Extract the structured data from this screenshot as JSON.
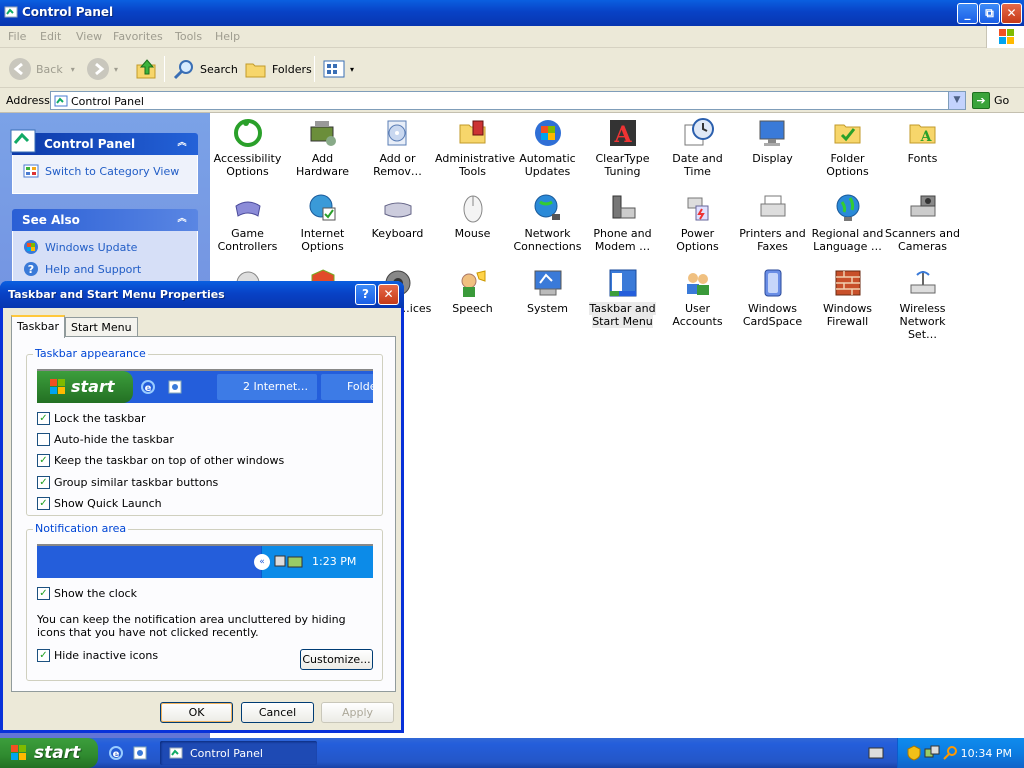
{
  "window": {
    "title": "Control Panel",
    "min_symbol": "_",
    "max_symbol": "⧉",
    "close_symbol": "✕"
  },
  "menu": [
    "File",
    "Edit",
    "View",
    "Favorites",
    "Tools",
    "Help"
  ],
  "toolbar": {
    "back": "Back",
    "search": "Search",
    "folders": "Folders"
  },
  "address": {
    "label": "Address",
    "value": "Control Panel",
    "go": "Go"
  },
  "taskpane": {
    "control_panel": {
      "title": "Control Panel",
      "link": "Switch to Category View"
    },
    "see_also": {
      "title": "See Also",
      "links": [
        "Windows Update",
        "Help and Support"
      ]
    }
  },
  "items": [
    {
      "label": "Accessibility Options",
      "icon": "accessibility-icon"
    },
    {
      "label": "Add Hardware",
      "icon": "add-hardware-icon"
    },
    {
      "label": "Add or Remov…",
      "icon": "add-remove-programs-icon"
    },
    {
      "label": "Administrative Tools",
      "icon": "administrative-tools-icon"
    },
    {
      "label": "Automatic Updates",
      "icon": "automatic-updates-icon"
    },
    {
      "label": "ClearType Tuning",
      "icon": "cleartype-icon"
    },
    {
      "label": "Date and Time",
      "icon": "date-time-icon"
    },
    {
      "label": "Display",
      "icon": "display-icon"
    },
    {
      "label": "Folder Options",
      "icon": "folder-options-icon"
    },
    {
      "label": "Fonts",
      "icon": "fonts-icon"
    },
    {
      "label": "Game Controllers",
      "icon": "game-controllers-icon"
    },
    {
      "label": "Internet Options",
      "icon": "internet-options-icon"
    },
    {
      "label": "Keyboard",
      "icon": "keyboard-icon"
    },
    {
      "label": "Mouse",
      "icon": "mouse-icon"
    },
    {
      "label": "Network Connections",
      "icon": "network-connections-icon"
    },
    {
      "label": "Phone and Modem …",
      "icon": "phone-modem-icon"
    },
    {
      "label": "Power Options",
      "icon": "power-options-icon"
    },
    {
      "label": "Printers and Faxes",
      "icon": "printers-faxes-icon"
    },
    {
      "label": "Regional and Language …",
      "icon": "regional-language-icon"
    },
    {
      "label": "Scanners and Cameras",
      "icon": "scanners-cameras-icon"
    },
    {
      "label": "",
      "icon": "hidden-item-icon"
    },
    {
      "label": "",
      "icon": "security-center-icon"
    },
    {
      "label": "…and …ices",
      "icon": "sounds-audio-icon"
    },
    {
      "label": "Speech",
      "icon": "speech-icon"
    },
    {
      "label": "System",
      "icon": "system-icon"
    },
    {
      "label": "Taskbar and Start Menu",
      "icon": "taskbar-start-menu-icon"
    },
    {
      "label": "User Accounts",
      "icon": "user-accounts-icon"
    },
    {
      "label": "Windows CardSpace",
      "icon": "cardspace-icon"
    },
    {
      "label": "Windows Firewall",
      "icon": "firewall-icon"
    },
    {
      "label": "Wireless Network Set…",
      "icon": "wireless-network-icon"
    }
  ],
  "dialog": {
    "title": "Taskbar and Start Menu Properties",
    "help_symbol": "?",
    "close_symbol": "✕",
    "tabs": [
      "Taskbar",
      "Start Menu"
    ],
    "appearance": {
      "label": "Taskbar appearance",
      "preview_start": "start",
      "preview_task1": "2 Internet…",
      "preview_task2": "Folde",
      "options": [
        {
          "label": "Lock the taskbar",
          "checked": true
        },
        {
          "label": "Auto-hide the taskbar",
          "checked": false
        },
        {
          "label": "Keep the taskbar on top of other windows",
          "checked": true
        },
        {
          "label": "Group similar taskbar buttons",
          "checked": true
        },
        {
          "label": "Show Quick Launch",
          "checked": true
        }
      ]
    },
    "notification": {
      "label": "Notification area",
      "preview_time": "1:23 PM",
      "show_clock": {
        "label": "Show the clock",
        "checked": true
      },
      "description": "You can keep the notification area uncluttered by hiding icons that you have not clicked recently.",
      "hide_inactive": {
        "label": "Hide inactive icons",
        "checked": true
      },
      "customize": "Customize..."
    },
    "buttons": {
      "ok": "OK",
      "cancel": "Cancel",
      "apply": "Apply"
    }
  },
  "taskbar": {
    "start": "start",
    "task": "Control Panel",
    "clock": "10:34 PM"
  }
}
